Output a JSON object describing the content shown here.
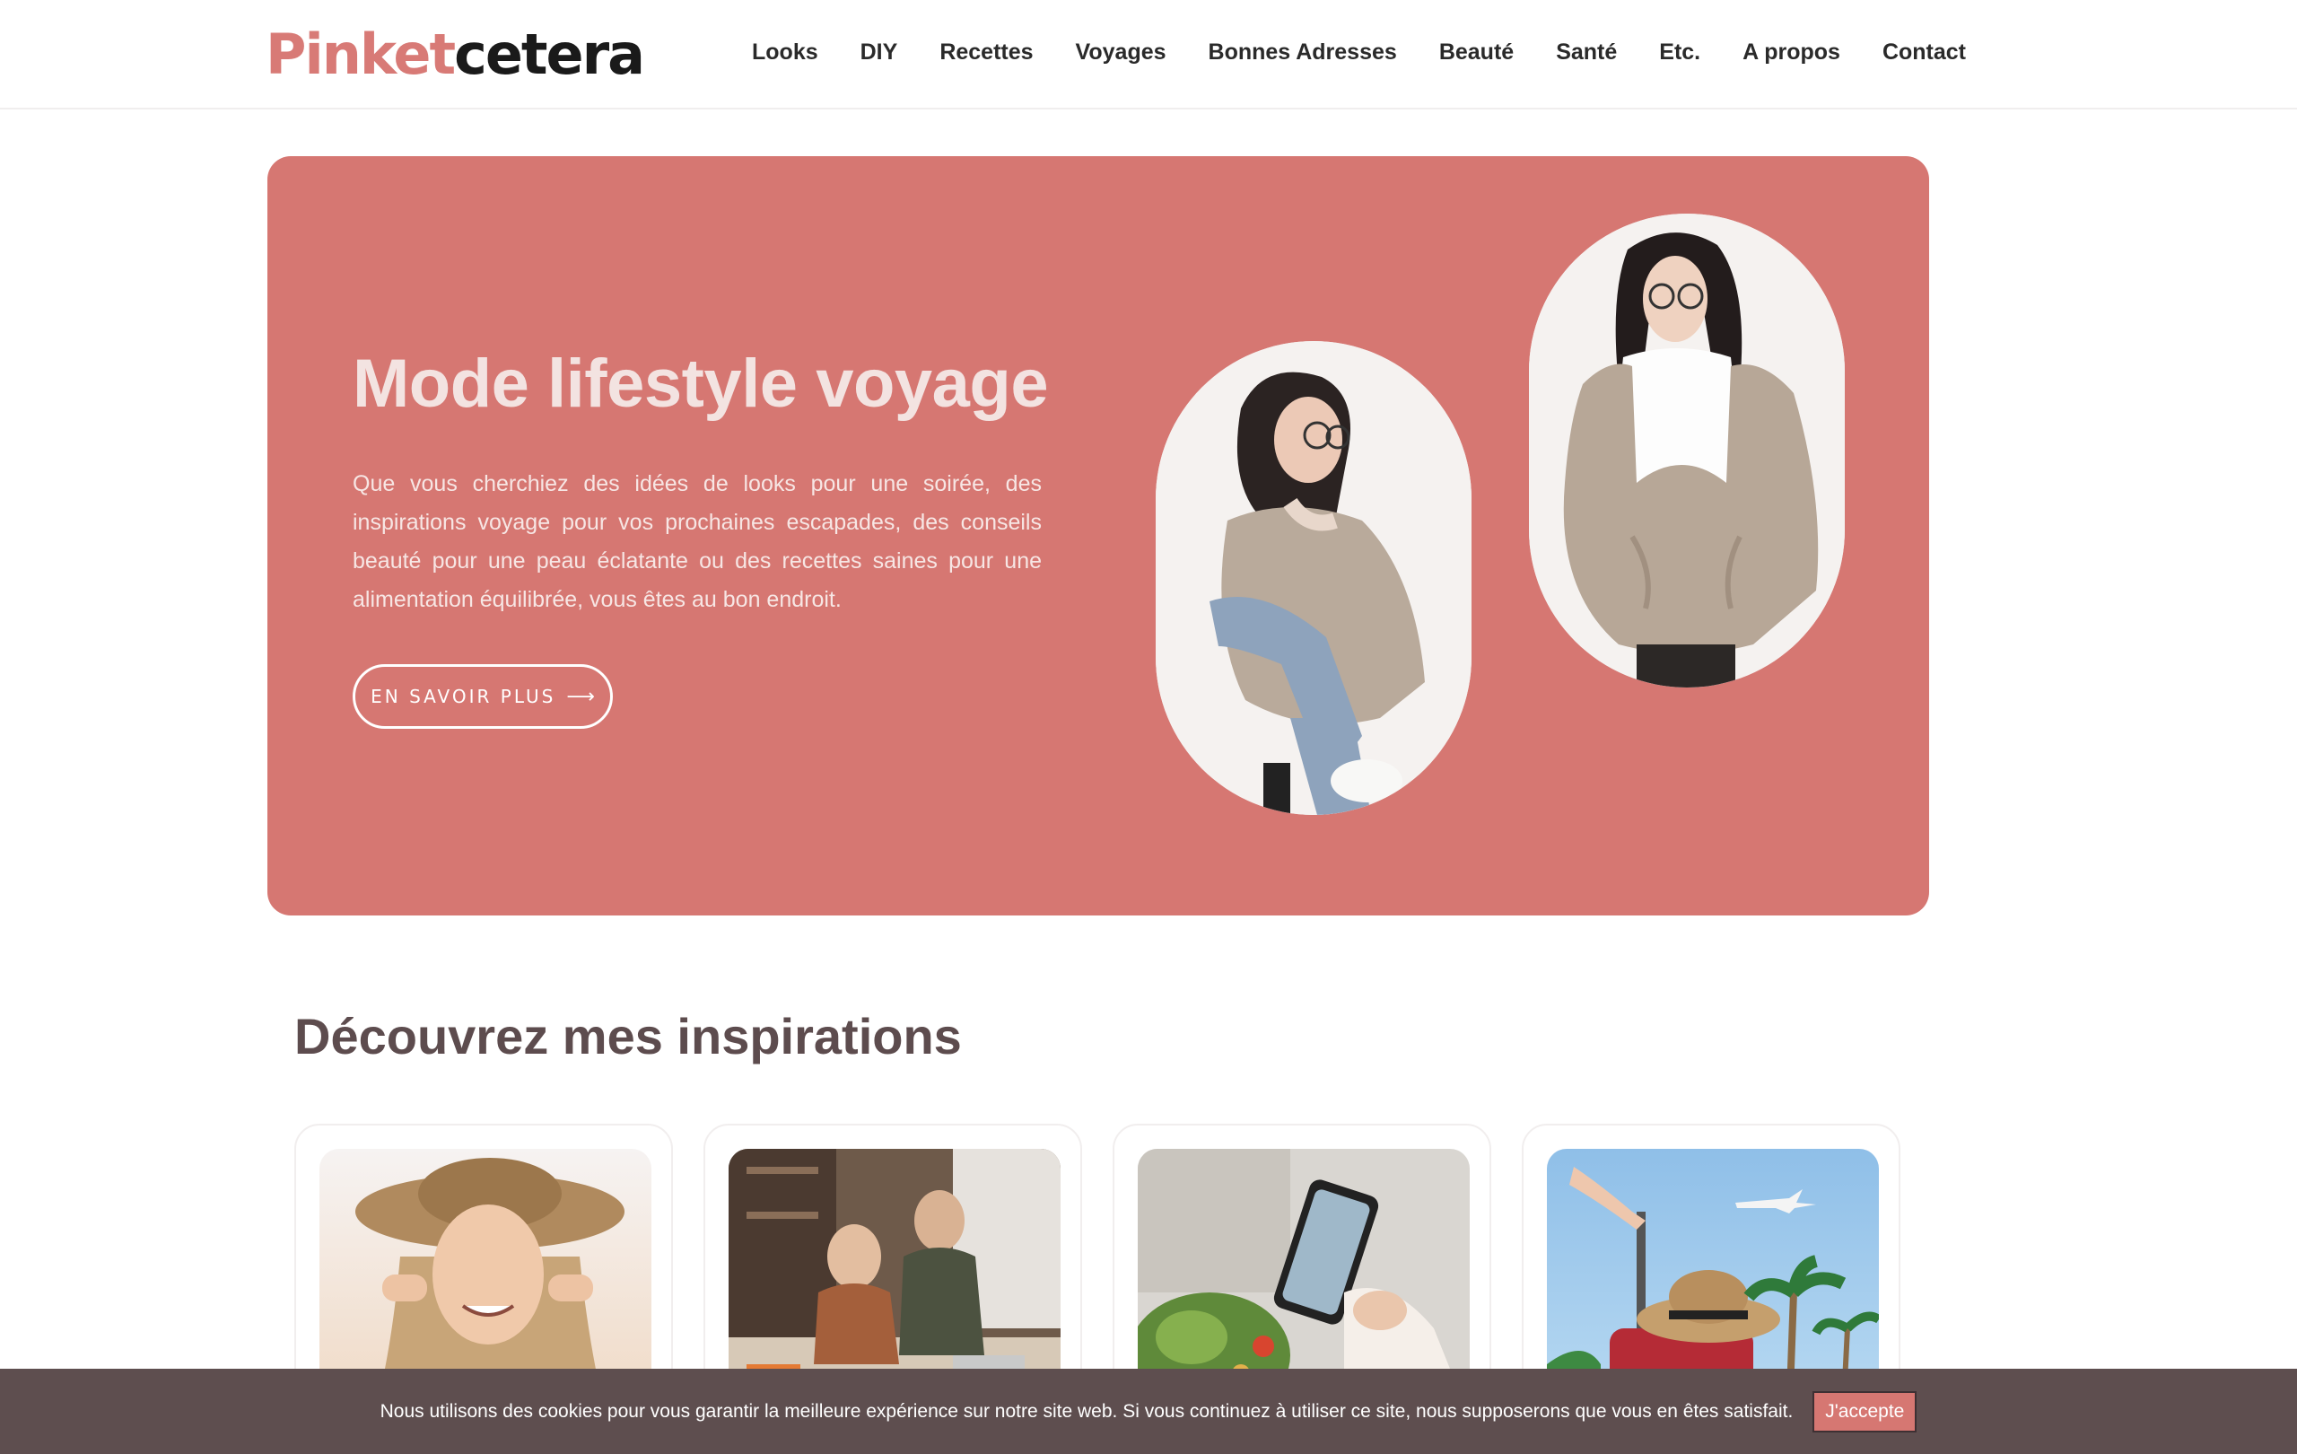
{
  "header": {
    "logo": {
      "part1": "Pinket",
      "part2": "cetera"
    },
    "nav": [
      "Looks",
      "DIY",
      "Recettes",
      "Voyages",
      "Bonnes Adresses",
      "Beauté",
      "Santé",
      "Etc.",
      "A propos",
      "Contact"
    ]
  },
  "hero": {
    "title": "Mode lifestyle voyage",
    "text": "Que vous cherchiez des idées de looks pour une soirée, des inspirations voyage pour vos prochaines escapades, des conseils beauté pour une peau éclatante ou des recettes saines pour une alimentation équilibrée, vous êtes au bon endroit.",
    "button_label": "EN SAVOIR PLUS",
    "button_arrow": "⟶",
    "background_color": "#d67772"
  },
  "section": {
    "title": "Découvrez mes inspirations"
  },
  "cookie": {
    "text": "Nous utilisons des cookies pour vous garantir la meilleure expérience sur notre site web. Si vous continuez à utiliser ce site, nous supposerons que vous en êtes satisfait.",
    "accept_label": "J'accepte"
  },
  "colors": {
    "accent": "#d67772",
    "cookie_bg": "#5e4e4f",
    "heading": "#5d4c4e"
  }
}
